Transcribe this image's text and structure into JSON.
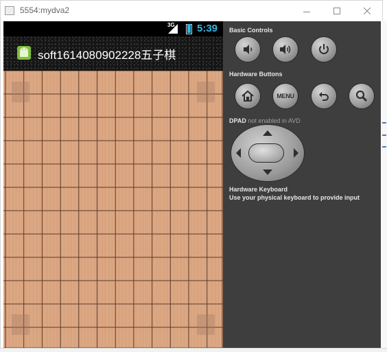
{
  "window": {
    "title": "5554:mydva2",
    "minimize_icon": "minimize-icon",
    "maximize_icon": "maximize-icon",
    "close_icon": "close-icon"
  },
  "device": {
    "status_bar": {
      "network": "3G",
      "time": "5:39",
      "battery_icon": "battery-icon",
      "signal_icon": "signal-icon"
    },
    "action_bar": {
      "icon": "android-icon",
      "title": "soft1614080902228五子棋"
    },
    "board": {
      "columns": 12,
      "rows": 12,
      "line_color": "#5a3a28",
      "wood_color": "#d9a37e"
    }
  },
  "controls": {
    "basic_controls_label": "Basic Controls",
    "basic_buttons": [
      {
        "name": "volume-down-button",
        "icon": "volume-down-icon"
      },
      {
        "name": "volume-up-button",
        "icon": "volume-up-icon"
      },
      {
        "name": "power-button",
        "icon": "power-icon"
      }
    ],
    "hardware_buttons_label": "Hardware Buttons",
    "hardware_buttons": [
      {
        "name": "home-button",
        "icon": "home-icon"
      },
      {
        "name": "menu-button",
        "label": "MENU"
      },
      {
        "name": "back-button",
        "icon": "back-icon"
      },
      {
        "name": "search-button",
        "icon": "search-icon"
      }
    ],
    "dpad_label": "DPAD",
    "dpad_note": "not enabled in AVD",
    "keyboard_label": "Hardware Keyboard",
    "keyboard_hint": "Use your physical keyboard to provide input"
  },
  "colors": {
    "panel_bg": "#3e3e3e",
    "status_accent": "#33b5e5"
  }
}
